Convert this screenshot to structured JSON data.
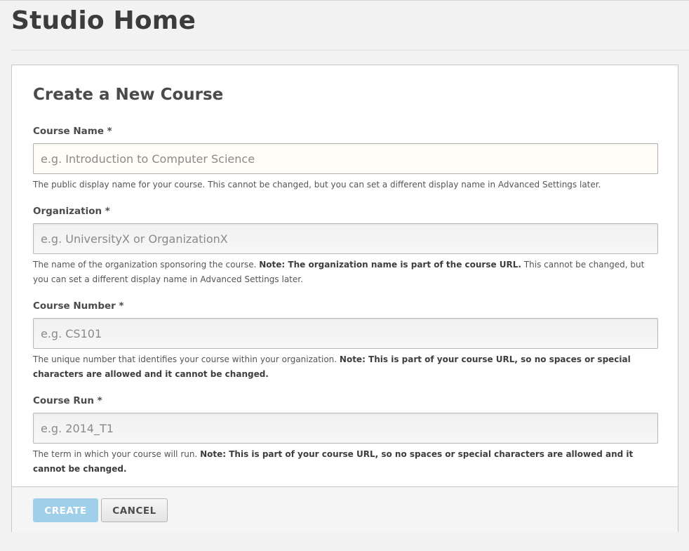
{
  "header": {
    "title": "Studio Home"
  },
  "form": {
    "title": "Create a New Course",
    "course_name": {
      "label": "Course Name *",
      "placeholder": "e.g. Introduction to Computer Science",
      "value": "",
      "tip": "The public display name for your course. This cannot be changed, but you can set a different display name in Advanced Settings later."
    },
    "organization": {
      "label": "Organization *",
      "placeholder": "e.g. UniversityX or OrganizationX",
      "value": "",
      "tip_pre": "The name of the organization sponsoring the course. ",
      "tip_note": "Note: The organization name is part of the course URL.",
      "tip_post": " This cannot be changed, but you can set a different display name in Advanced Settings later."
    },
    "course_number": {
      "label": "Course Number *",
      "placeholder": "e.g. CS101",
      "value": "",
      "tip_pre": "The unique number that identifies your course within your organization. ",
      "tip_note": "Note: This is part of your course URL, so no spaces or special characters are allowed and it cannot be changed."
    },
    "course_run": {
      "label": "Course Run *",
      "placeholder": "e.g. 2014_T1",
      "value": "",
      "tip_pre": "The term in which your course will run. ",
      "tip_note": "Note: This is part of your course URL, so no spaces or special characters are allowed and it cannot be changed."
    },
    "actions": {
      "create_label": "CREATE",
      "cancel_label": "CANCEL"
    }
  }
}
